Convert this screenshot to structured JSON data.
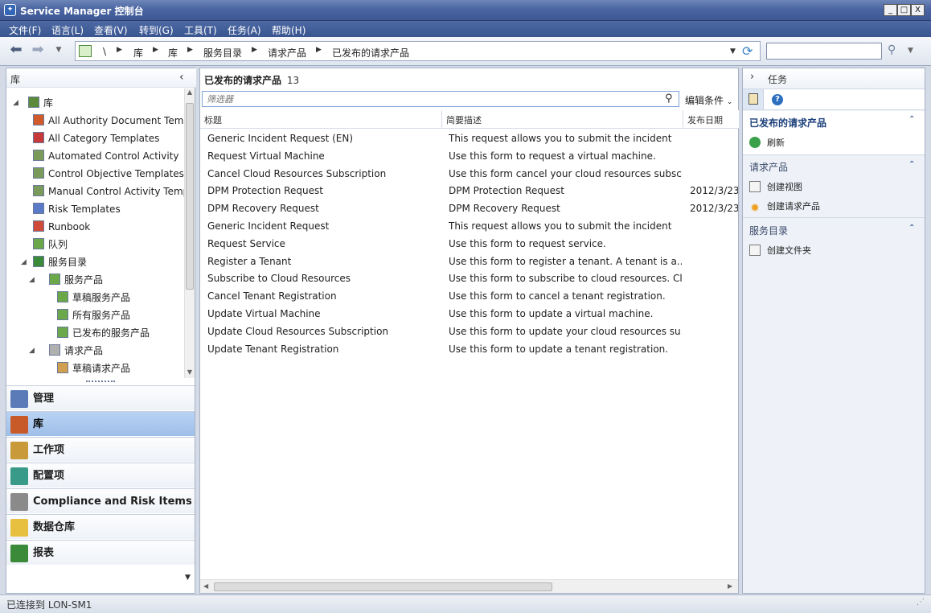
{
  "window": {
    "title": "Service Manager 控制台",
    "min_label": "_",
    "max_label": "□",
    "close_label": "X"
  },
  "menu": [
    "文件(F)",
    "语言(L)",
    "查看(V)",
    "转到(G)",
    "工具(T)",
    "任务(A)",
    "帮助(H)"
  ],
  "breadcrumb": [
    "\\",
    "库",
    "库",
    "服务目录",
    "请求产品",
    "已发布的请求产品"
  ],
  "left_pane": {
    "header": "库",
    "tree": [
      {
        "label": "库",
        "indent": 1,
        "expander": "◢",
        "icon_color": "#5a8a3a"
      },
      {
        "label": "All Authority Document Templates",
        "indent": 2,
        "icon_color": "#d05a2a"
      },
      {
        "label": "All Category Templates",
        "indent": 2,
        "icon_color": "#c83a3a"
      },
      {
        "label": "Automated Control Activity",
        "indent": 2,
        "icon_color": "#7a9a5a"
      },
      {
        "label": "Control Objective Templates",
        "indent": 2,
        "icon_color": "#7a9a5a"
      },
      {
        "label": "Manual Control Activity Templates",
        "indent": 2,
        "icon_color": "#7a9a5a"
      },
      {
        "label": "Risk Templates",
        "indent": 2,
        "icon_color": "#5a7ac8"
      },
      {
        "label": "Runbook",
        "indent": 2,
        "icon_color": "#d04a3a"
      },
      {
        "label": "队列",
        "indent": 2,
        "icon_color": "#6aa84a"
      },
      {
        "label": "服务目录",
        "indent": 2,
        "expander": "◢",
        "icon_color": "#3a8a3a"
      },
      {
        "label": "服务产品",
        "indent": 3,
        "expander": "◢",
        "icon_color": "#6aa84a"
      },
      {
        "label": "草稿服务产品",
        "indent": 4,
        "icon_color": "#6aa84a"
      },
      {
        "label": "所有服务产品",
        "indent": 4,
        "icon_color": "#6aa84a"
      },
      {
        "label": "已发布的服务产品",
        "indent": 4,
        "icon_color": "#6aa84a"
      },
      {
        "label": "请求产品",
        "indent": 3,
        "expander": "◢",
        "icon_color": "#b0b0b0"
      },
      {
        "label": "草稿请求产品",
        "indent": 4,
        "icon_color": "#d0a050"
      }
    ],
    "workspaces": [
      {
        "label": "管理",
        "icon_color": "#5a7ab8",
        "selected": false
      },
      {
        "label": "库",
        "icon_color": "#c85a2a",
        "selected": true
      },
      {
        "label": "工作项",
        "icon_color": "#c89a3a",
        "selected": false
      },
      {
        "label": "配置项",
        "icon_color": "#3a9a8a",
        "selected": false
      },
      {
        "label": "Compliance and Risk Items",
        "icon_color": "#8a8a8a",
        "selected": false
      },
      {
        "label": "数据仓库",
        "icon_color": "#e8c040",
        "selected": false
      },
      {
        "label": "报表",
        "icon_color": "#3a8a3a",
        "selected": false
      }
    ]
  },
  "center": {
    "title": "已发布的请求产品",
    "count": "13",
    "filter_placeholder": "筛选器",
    "edit_criteria": "编辑条件",
    "columns": [
      "标题",
      "简要描述",
      "发布日期"
    ],
    "rows": [
      {
        "title": "Generic Incident Request (EN)",
        "desc": "This request allows you to submit the incident",
        "date": ""
      },
      {
        "title": "Request Virtual Machine",
        "desc": "Use this form to request a virtual machine.",
        "date": ""
      },
      {
        "title": "Cancel Cloud Resources Subscription",
        "desc": "Use this form cancel your cloud resources subsc...",
        "date": ""
      },
      {
        "title": "DPM Protection Request",
        "desc": "DPM Protection Request",
        "date": "2012/3/23"
      },
      {
        "title": "DPM Recovery Request",
        "desc": "DPM Recovery Request",
        "date": "2012/3/23"
      },
      {
        "title": "Generic Incident Request",
        "desc": "This request allows you to submit the incident",
        "date": ""
      },
      {
        "title": "Request Service",
        "desc": "Use this form to request service.",
        "date": ""
      },
      {
        "title": "Register a Tenant",
        "desc": "Use this form to register a tenant.  A tenant is a...",
        "date": ""
      },
      {
        "title": "Subscribe to Cloud Resources",
        "desc": "Use this form to subscribe to cloud resources. Cl...",
        "date": ""
      },
      {
        "title": "Cancel Tenant Registration",
        "desc": "Use this form to cancel a tenant registration.",
        "date": ""
      },
      {
        "title": "Update Virtual Machine",
        "desc": "Use this form to update a virtual machine.",
        "date": ""
      },
      {
        "title": "Update Cloud Resources Subscription",
        "desc": "Use this form to update your cloud resources su...",
        "date": ""
      },
      {
        "title": "Update Tenant Registration",
        "desc": "Use this form to update a tenant registration.",
        "date": ""
      }
    ]
  },
  "right_pane": {
    "header": "任务",
    "sections": [
      {
        "title": "已发布的请求产品",
        "items": [
          {
            "label": "刷新",
            "icon": "refresh-icon"
          }
        ]
      },
      {
        "title": "请求产品",
        "items": [
          {
            "label": "创建视图",
            "icon": "view-icon"
          },
          {
            "label": "创建请求产品",
            "icon": "star-icon"
          }
        ]
      },
      {
        "title": "服务目录",
        "items": [
          {
            "label": "创建文件夹",
            "icon": "folder-icon"
          }
        ]
      }
    ]
  },
  "status": {
    "text": "已连接到 LON-SM1"
  }
}
